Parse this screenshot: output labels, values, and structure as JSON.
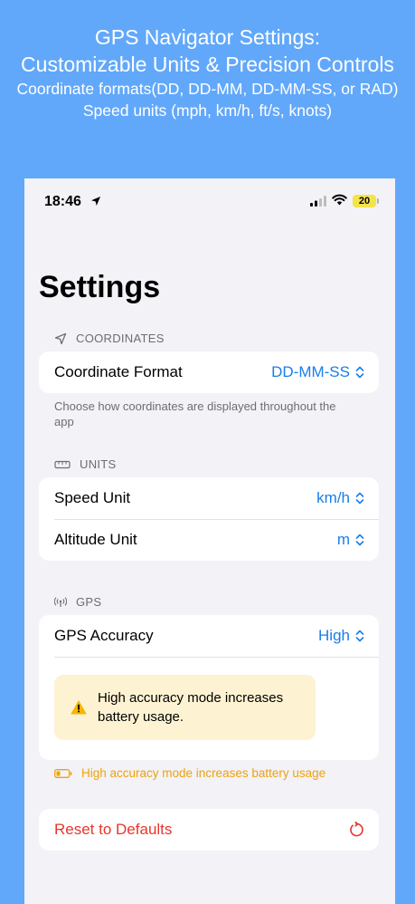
{
  "promo": {
    "line1": "GPS Navigator Settings:",
    "line2": "Customizable Units & Precision Controls",
    "line3": "Coordinate formats(DD, DD-MM, DD-MM-SS, or RAD)",
    "line4": "Speed units (mph, km/h, ft/s, knots)"
  },
  "status_bar": {
    "time": "18:46",
    "battery": "20"
  },
  "page": {
    "title": "Settings"
  },
  "coordinates": {
    "header": "COORDINATES",
    "format_label": "Coordinate Format",
    "format_value": "DD-MM-SS",
    "footnote": "Choose how coordinates are displayed throughout the app"
  },
  "units": {
    "header": "UNITS",
    "speed_label": "Speed Unit",
    "speed_value": "km/h",
    "altitude_label": "Altitude Unit",
    "altitude_value": "m"
  },
  "gps": {
    "header": "GPS",
    "accuracy_label": "GPS Accuracy",
    "accuracy_value": "High",
    "warning_text": "High accuracy mode increases battery usage.",
    "footnote": "High accuracy mode increases battery usage"
  },
  "reset": {
    "label": "Reset to Defaults"
  },
  "colors": {
    "background": "#62a8fa",
    "accent": "#1a7ee8",
    "destructive": "#e8352b",
    "warning": "#f0a20d",
    "warning_box": "#fdf3d2"
  }
}
